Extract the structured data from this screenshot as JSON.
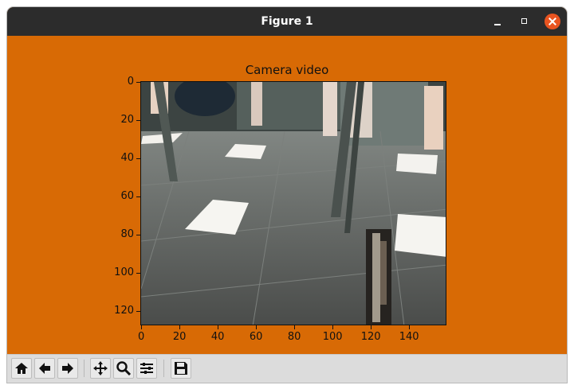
{
  "window": {
    "title": "Figure 1"
  },
  "figure": {
    "title": "Camera video",
    "y_ticks": [
      "0",
      "20",
      "40",
      "60",
      "80",
      "100",
      "120"
    ],
    "x_ticks": [
      "0",
      "20",
      "40",
      "60",
      "80",
      "100",
      "120",
      "140"
    ],
    "background_color": "#d86a05"
  },
  "toolbar": {
    "buttons": [
      "home-icon",
      "back-arrow-icon",
      "forward-arrow-icon",
      "pan-icon",
      "zoom-icon",
      "configure-subplots-icon",
      "save-icon"
    ]
  }
}
